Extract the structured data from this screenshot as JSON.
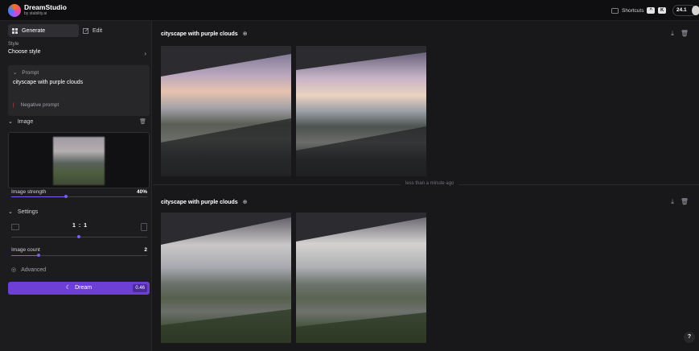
{
  "app": {
    "name": "DreamStudio",
    "byline": "by stability.ai"
  },
  "header": {
    "shortcuts_label": "Shortcuts",
    "shortcut_keys": [
      "^",
      "K"
    ],
    "credits": "24.1"
  },
  "sidebar": {
    "tabs": [
      {
        "label": "Generate",
        "icon": "generate-icon"
      },
      {
        "label": "Edit",
        "icon": "edit-icon"
      }
    ],
    "style": {
      "label": "Style",
      "value": "Choose style"
    },
    "prompt": {
      "label": "Prompt",
      "text": "cityscape with purple clouds"
    },
    "negative_prompt": {
      "label": "Negative prompt"
    },
    "image": {
      "label": "Image",
      "strength_label": "Image strength",
      "strength_value": "40%",
      "strength_fraction": 0.4
    },
    "settings": {
      "label": "Settings",
      "aspect_ratio": "1 : 1",
      "image_count_label": "Image count",
      "image_count_value": "2",
      "image_count_fraction": 0.2
    },
    "advanced_label": "Advanced",
    "dream": {
      "label": "Dream",
      "cost": "0.46"
    }
  },
  "main": {
    "generations": [
      {
        "prompt": "cityscape with purple clouds",
        "images": [
          "generated-image-1",
          "generated-image-2"
        ]
      },
      {
        "prompt": "cityscape with purple clouds",
        "images": [
          "generated-image-3",
          "generated-image-4"
        ]
      }
    ],
    "divider_label": "less than a minute ago"
  },
  "colors": {
    "accent": "#6d3fd6",
    "background": "#18181b",
    "sidebar": "#1c1c1f"
  },
  "help_label": "?"
}
